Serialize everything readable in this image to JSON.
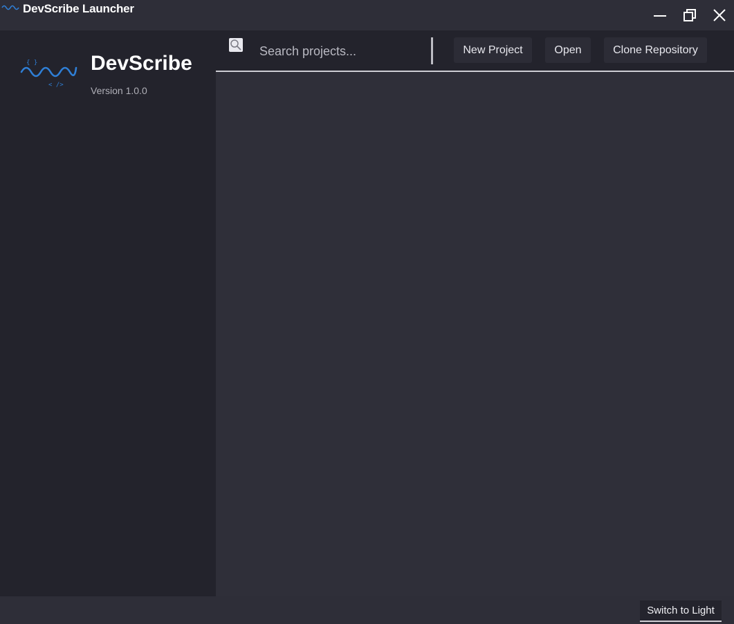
{
  "window": {
    "title": "DevScribe Launcher",
    "icon": "wave-logo-icon",
    "controls": {
      "minimize": "minimize-icon",
      "maximize": "restore-icon",
      "close": "close-icon"
    }
  },
  "sidebar": {
    "brand_name": "DevScribe",
    "version": "Version 1.0.0",
    "logo": {
      "icon": "wave-logo-icon",
      "top_glyph": "{ }",
      "bottom_glyph": "< />"
    }
  },
  "toolbar": {
    "search": {
      "icon": "search-icon",
      "placeholder": "Search projects...",
      "value": ""
    },
    "new_project_label": "New Project",
    "open_label": "Open",
    "clone_label": "Clone Repository"
  },
  "footer": {
    "theme_toggle_label": "Switch to Light"
  },
  "colors": {
    "accent": "#2f7fd6",
    "sidebar_bg": "#23232c",
    "content_bg": "#2f2f39",
    "button_bg": "#2c2c36",
    "text": "#ffffff"
  }
}
